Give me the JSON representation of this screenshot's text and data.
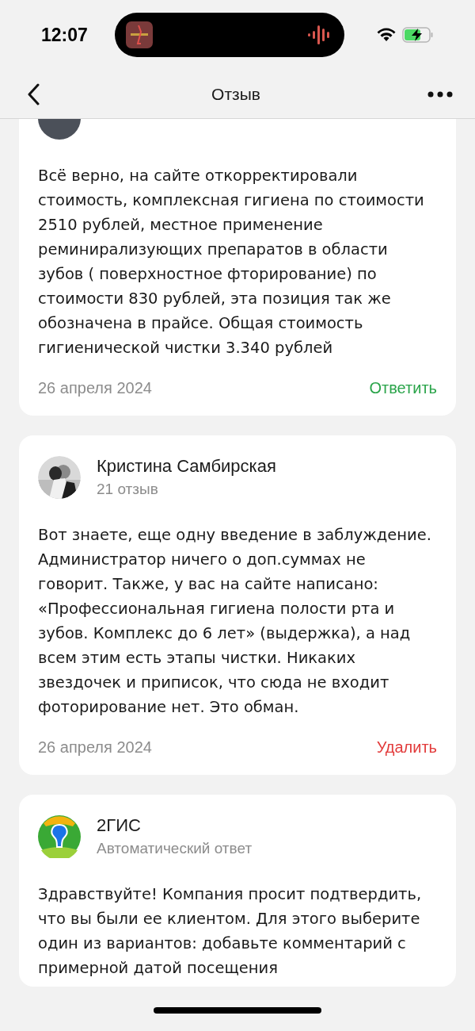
{
  "status_bar": {
    "time": "12:07"
  },
  "header": {
    "title": "Отзыв"
  },
  "reviews": [
    {
      "avatar": {
        "kind": "plain"
      },
      "text": "Всё верно, на сайте откорректировали стоимость, комплексная гигиена по стоимости 2510 рублей, местное применение реминирализующих препаратов в области зубов ( поверхностное фторирование) по стоимости 830 рублей, эта позиция так же обозначена в прайсе. Общая стоимость гигиенической чистки 3.340 рублей",
      "date": "26 апреля 2024",
      "action": {
        "kind": "reply",
        "label": "Ответить"
      }
    },
    {
      "author": "Кристина Самбирская",
      "subtitle": "21 отзыв",
      "text": "Вот знаете, еще одну введение в заблуждение. Администратор ничего о доп.суммах не говорит. Также, у вас на сайте написано: «Профессиональная гигиена полости рта и зубов. Комплекс до 6 лет» (выдержка), а над всем этим есть этапы чистки. Никаких звездочек и приписок, что сюда не входит фоторирование нет. Это обман.",
      "date": "26 апреля 2024",
      "action": {
        "kind": "delete",
        "label": "Удалить"
      }
    },
    {
      "avatar": {
        "kind": "logo"
      },
      "author": "2ГИС",
      "subtitle": "Автоматический ответ",
      "text": "Здравствуйте! Компания просит подтвердить, что вы были ее клиентом. Для этого выберите один из вариантов: добавьте комментарий с примерной датой посещения"
    }
  ]
}
